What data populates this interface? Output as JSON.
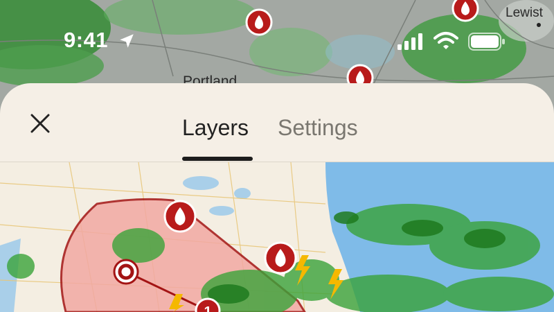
{
  "status_bar": {
    "time": "9:41",
    "icons": [
      "location-arrow-icon",
      "cellular-signal-icon",
      "wifi-icon",
      "battery-icon"
    ]
  },
  "background_map": {
    "labels": [
      "Lewist",
      "Portland"
    ],
    "markers": [
      "fire-icon",
      "fire-icon",
      "fire-icon"
    ]
  },
  "sheet": {
    "close_icon": "close-icon",
    "tabs": [
      {
        "label": "Layers",
        "active": true
      },
      {
        "label": "Settings",
        "active": false
      }
    ]
  },
  "preview_map": {
    "markers": [
      "fire-icon",
      "fire-icon",
      "storm-center-icon",
      "storm-number-icon"
    ],
    "lightning_icons": [
      "lightning-icon",
      "lightning-icon",
      "lightning-icon"
    ],
    "storm_number": "1"
  },
  "colors": {
    "sheet_background": "#f5efe6",
    "fire_marker": "#b81b1b",
    "storm_cone_fill": "#f2a9a3",
    "water": "#7fbbe8",
    "lightning": "#f5b800",
    "radar_green": "#3aa33a"
  }
}
